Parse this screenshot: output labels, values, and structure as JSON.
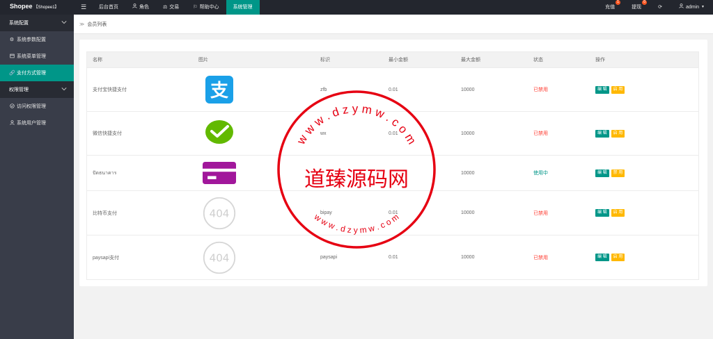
{
  "app": {
    "brand": "Shopee",
    "brand_suffix": "【Shopee1】"
  },
  "nav": {
    "toggle_icon": "menu-icon",
    "items": [
      {
        "label": "后台首页",
        "icon": ""
      },
      {
        "label": "角色",
        "icon": "user-icon"
      },
      {
        "label": "交易",
        "icon": "scale-icon"
      },
      {
        "label": "帮助中心",
        "icon": "flag-icon"
      },
      {
        "label": "系统管理",
        "icon": "",
        "active": true
      }
    ]
  },
  "right_nav": {
    "recharge": {
      "label": "充值",
      "badge": "1"
    },
    "withdraw": {
      "label": "提现",
      "badge": "0"
    },
    "refresh_icon": "refresh-icon",
    "user": "admin"
  },
  "sidebar": {
    "groups": [
      {
        "label": "系统配置",
        "items": [
          {
            "label": "系统参数配置",
            "icon": "gear-icon"
          },
          {
            "label": "系统菜单管理",
            "icon": "window-icon"
          },
          {
            "label": "支付方式管理",
            "icon": "link-icon",
            "active": true
          }
        ]
      },
      {
        "label": "权限管理",
        "items": [
          {
            "label": "访问权限管理",
            "icon": "check-circle-icon"
          },
          {
            "label": "系统用户管理",
            "icon": "user-icon"
          }
        ]
      }
    ]
  },
  "breadcrumb": {
    "current": "会员列表"
  },
  "table": {
    "headers": [
      "名称",
      "图片",
      "标识",
      "最小金额",
      "最大金额",
      "状态",
      "操作"
    ],
    "rows": [
      {
        "name": "支付宝快捷支付",
        "image": "alipay-logo",
        "code": "zfb",
        "min": "0.01",
        "max": "10000",
        "status": "已禁用",
        "status_on": false,
        "toggle": "启 用"
      },
      {
        "name": "微信快捷支付",
        "image": "wechat-logo",
        "code": "wx",
        "min": "0.01",
        "max": "10000",
        "status": "已禁用",
        "status_on": false,
        "toggle": "启 用"
      },
      {
        "name": "ปัดธนาคาร",
        "image": "bank-card-logo",
        "code": "",
        "min": "",
        "max": "10000",
        "status": "使用中",
        "status_on": true,
        "toggle": "禁 用"
      },
      {
        "name": "比特币支付",
        "image": "404-placeholder",
        "code": "bipay",
        "min": "0.01",
        "max": "10000",
        "status": "已禁用",
        "status_on": false,
        "toggle": "启 用"
      },
      {
        "name": "paysapi支付",
        "image": "404-placeholder",
        "code": "paysapi",
        "min": "0.01",
        "max": "10000",
        "status": "已禁用",
        "status_on": false,
        "toggle": "启 用"
      }
    ],
    "edit_label": "编 辑",
    "placeholder_404": "404"
  },
  "watermark": {
    "center": "道臻源码网",
    "top": "w w w . d z y m w . c o m",
    "bottom": "w w w . d z y m w . c o m",
    "color": "#e60012"
  },
  "colors": {
    "accent": "#009688",
    "warn": "#ffb800",
    "danger": "#ff3b30",
    "topbar": "#23262e",
    "sidebar": "#393d49"
  }
}
